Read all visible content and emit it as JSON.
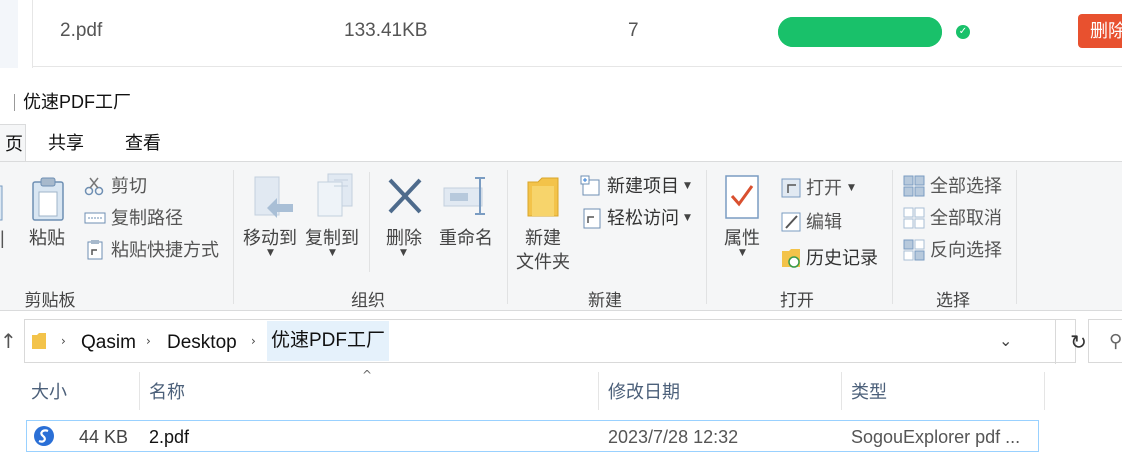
{
  "top_row": {
    "file_name": "2.pdf",
    "file_size": "133.41KB",
    "pages": "7",
    "progress": 1.0,
    "status": "done",
    "delete_label": "删除",
    "accent_color": "#19c16a",
    "delete_color": "#e8512f"
  },
  "window": {
    "title": "优速PDF工厂",
    "tabs": [
      "页",
      "共享",
      "查看"
    ]
  },
  "ribbon": {
    "clipboard": {
      "group_label": "剪贴板",
      "paste_label": "粘贴",
      "cut_label": "剪切",
      "copy_path_label": "复制路径",
      "paste_shortcut_label": "粘贴快捷方式"
    },
    "organize": {
      "group_label": "组织",
      "move_to_label": "移动到",
      "copy_to_label": "复制到",
      "delete_label": "删除",
      "rename_label": "重命名"
    },
    "new": {
      "group_label": "新建",
      "new_folder_line1": "新建",
      "new_folder_line2": "文件夹",
      "new_item_label": "新建项目",
      "easy_access_label": "轻松访问"
    },
    "open": {
      "group_label": "打开",
      "properties_label": "属性",
      "open_label": "打开",
      "edit_label": "编辑",
      "history_label": "历史记录"
    },
    "select": {
      "group_label": "选择",
      "select_all_label": "全部选择",
      "select_none_label": "全部取消",
      "invert_label": "反向选择"
    }
  },
  "address": {
    "crumbs": [
      "Qasim",
      "Desktop",
      "优速PDF工厂"
    ]
  },
  "file_list": {
    "columns": [
      "大小",
      "名称",
      "修改日期",
      "类型"
    ],
    "rows": [
      {
        "size": "44 KB",
        "name": "2.pdf",
        "modified": "2023/7/28 12:32",
        "type": "SogouExplorer pdf ..."
      }
    ]
  }
}
